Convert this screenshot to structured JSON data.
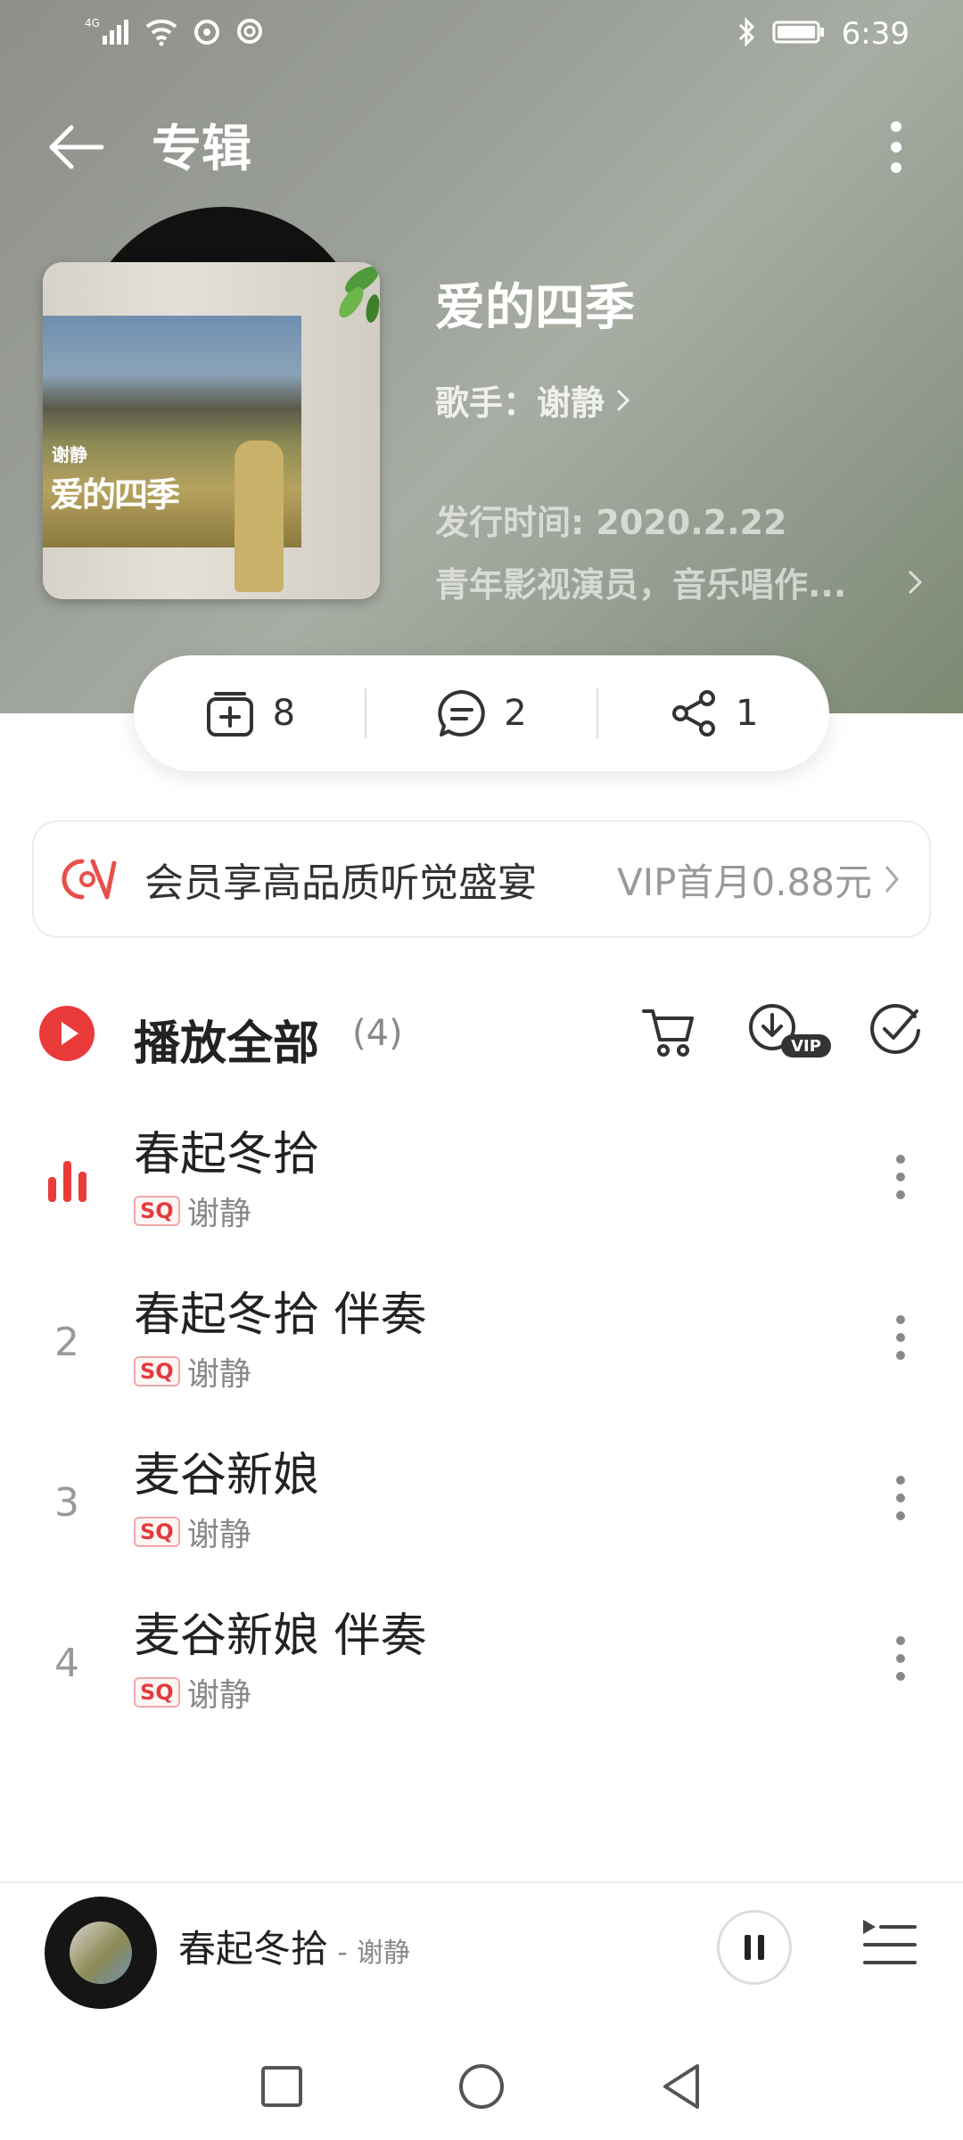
{
  "status_bar": {
    "network": "4G",
    "time": "6:39"
  },
  "top_bar": {
    "title": "专辑"
  },
  "album": {
    "cover_artist_text": "谢静",
    "cover_title_text": "爱的四季",
    "name": "爱的四季",
    "artist_label": "歌手：谢静",
    "release_date": "发行时间: 2020.2.22",
    "description": "青年影视演员，音乐唱作..."
  },
  "stats": {
    "collect_count": "8",
    "comment_count": "2",
    "share_count": "1"
  },
  "vip_banner": {
    "text": "会员享高品质听觉盛宴",
    "price": "VIP首月0.88元"
  },
  "play_all": {
    "label": "播放全部",
    "count": "(4)",
    "vip_badge": "VIP"
  },
  "songs": [
    {
      "index": "1",
      "title": "春起冬拾",
      "badge": "SQ",
      "artist": "谢静",
      "playing": true
    },
    {
      "index": "2",
      "title": "春起冬拾 伴奏",
      "badge": "SQ",
      "artist": "谢静",
      "playing": false
    },
    {
      "index": "3",
      "title": "麦谷新娘",
      "badge": "SQ",
      "artist": "谢静",
      "playing": false
    },
    {
      "index": "4",
      "title": "麦谷新娘 伴奏",
      "badge": "SQ",
      "artist": "谢静",
      "playing": false
    }
  ],
  "mini_player": {
    "title": "春起冬拾",
    "separator": " - ",
    "artist": "谢静"
  },
  "colors": {
    "accent_red": "#ea3b3b",
    "header_gray": "#9a9f97"
  }
}
